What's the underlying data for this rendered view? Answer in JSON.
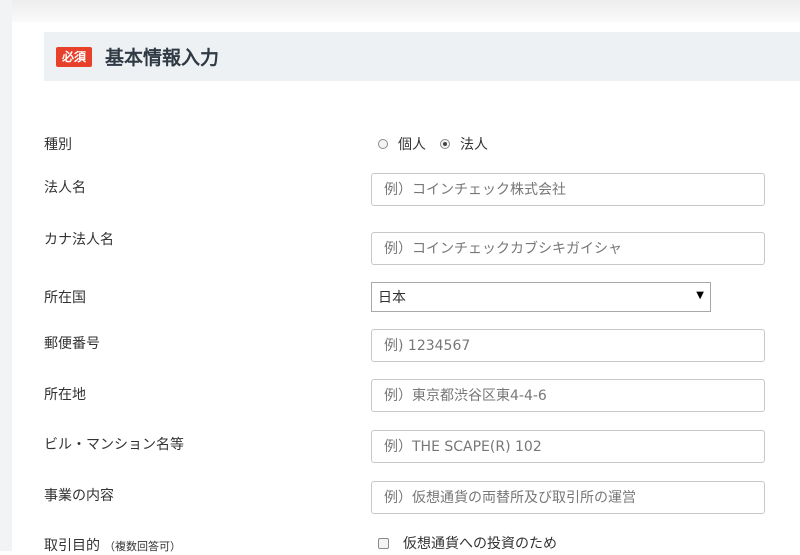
{
  "section": {
    "badge": "必須",
    "title": "基本情報入力"
  },
  "rows": {
    "type": {
      "label": "種別",
      "options": [
        {
          "label": "個人",
          "checked": false
        },
        {
          "label": "法人",
          "checked": true
        }
      ]
    },
    "corp_name": {
      "label": "法人名",
      "placeholder": "例）コインチェック株式会社"
    },
    "corp_kana": {
      "label": "カナ法人名",
      "placeholder": "例）コインチェックカブシキガイシャ"
    },
    "country": {
      "label": "所在国",
      "selected": "日本"
    },
    "postal": {
      "label": "郵便番号",
      "placeholder": "例) 1234567"
    },
    "address": {
      "label": "所在地",
      "placeholder": "例）東京都渋谷区東4-4-6"
    },
    "building": {
      "label": "ビル・マンション名等",
      "placeholder": "例）THE SCAPE(R) 102"
    },
    "business": {
      "label": "事業の内容",
      "placeholder": "例）仮想通貨の両替所及び取引所の運営"
    },
    "purpose": {
      "label": "取引目的",
      "note": "（複数回答可）",
      "option_label": "仮想通貨への投資のため"
    }
  },
  "colors": {
    "badge": "#e8412b",
    "header_bg": "#eef1f4"
  }
}
